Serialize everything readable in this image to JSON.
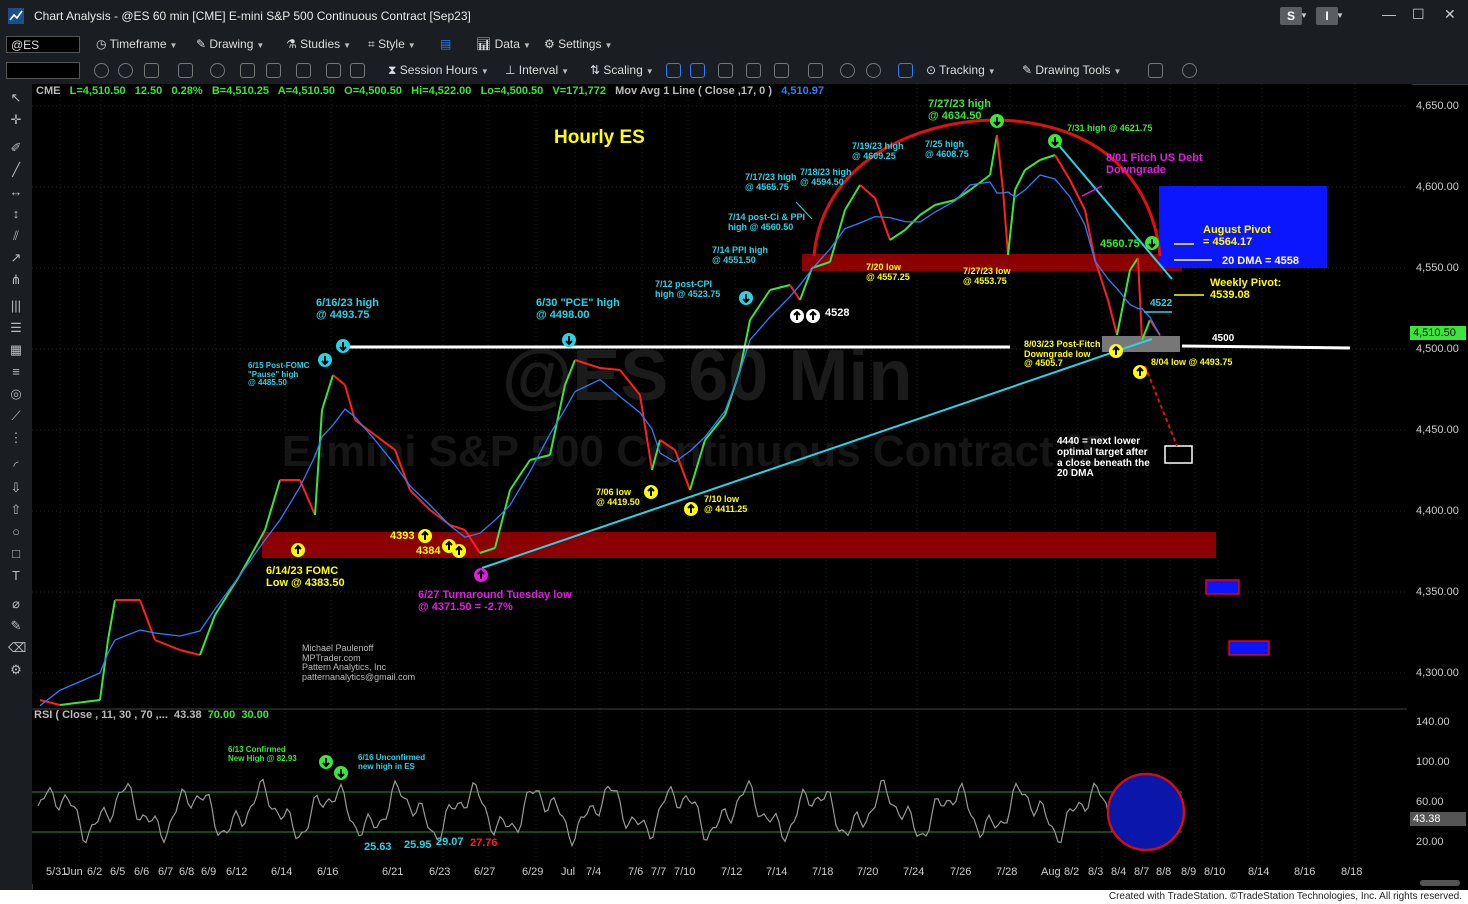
{
  "window": {
    "title": "Chart Analysis - @ES 60 min [CME] E-mini S&P 500 Continuous Contract [Sep23]",
    "buttons": [
      "S",
      "I"
    ]
  },
  "toolbar1": {
    "symbol": "@ES",
    "items": [
      "Timeframe",
      "Drawing",
      "Studies",
      "Style",
      "Data",
      "Settings"
    ]
  },
  "toolbar2": {
    "items": [
      "Session Hours",
      "Interval",
      "Scaling",
      "Tracking",
      "Drawing Tools"
    ]
  },
  "header": {
    "exchange": "CME",
    "last": "L=4,510.50",
    "change": "12.50",
    "pct": "0.28%",
    "bid": "B=4,510.25",
    "ask": "A=4,510.50",
    "open": "O=4,500.50",
    "hi": "Hi=4,522.00",
    "lo": "Lo=4,500.50",
    "vol": "V=171,772",
    "study": "Mov Avg 1 Line ( Close ,17, 0 )",
    "study_value": "4,510.97"
  },
  "price_axis": [
    "4,650.00",
    "4,600.00",
    "4,550.00",
    "4,500.00",
    "4,450.00",
    "4,400.00",
    "4,350.00",
    "4,300.00"
  ],
  "current_price": "4,510.50",
  "rsi_axis": [
    "140.00",
    "100.00",
    "60.00",
    "20.00"
  ],
  "rsi_current": "43.38",
  "rsi_header": {
    "label": "RSI ( Close , 11, 30 , 70 ,...",
    "value": "43.38",
    "ob": "70.00",
    "os": "30.00"
  },
  "date_axis": [
    "5/31",
    "Jun",
    "6/2",
    "6/5",
    "6/6",
    "6/7",
    "6/8",
    "6/9",
    "6/12",
    "6/14",
    "6/16",
    "6/21",
    "6/23",
    "6/27",
    "6/29",
    "Jul",
    "7/4",
    "7/6",
    "7/7",
    "7/10",
    "7/12",
    "7/14",
    "7/18",
    "7/20",
    "7/24",
    "7/26",
    "7/28",
    "Aug",
    "8/2",
    "8/3",
    "8/4",
    "8/7",
    "8/8",
    "8/9",
    "8/10",
    "8/14",
    "8/16",
    "8/18"
  ],
  "watermark": {
    "line1": "@ES 60 Min",
    "line2": "E-mini S&P 500 Continuous Contract [S"
  },
  "annotations": {
    "title": "Hourly ES",
    "h616": "6/16/23 high\n@ 4493.75",
    "h630": "6/30 \"PCE\" high\n@ 4498.00",
    "pause615": "6/15 Post-FOMC\n\"Pause\" high\n@ 4485.50",
    "fomc614": "6/14/23 FOMC\nLow @ 4383.50",
    "l4393": "4393",
    "l4384": "4384",
    "tt627": "6/27 Turnaround Tuesday low\n@ 4371.50 = -2.7%",
    "l706": "7/06 low\n@ 4419.50",
    "l710": "7/10 low\n@ 4411.25",
    "cpi712": "7/12 post-CPI\nhigh @ 4523.75",
    "ppi714": "7/14 PPI high\n@ 4551.50",
    "ci714": "7/14 post-Ci & PPI\nhigh @ 4560.50",
    "h717": "7/17/23 high\n@ 4565.75",
    "h718": "7/18/23 high\n@ 4594.50",
    "h719": "7/19/23 high\n@ 4609.25",
    "h725": "7/25 high\n@ 4608.75",
    "h727": "7/27/23 high\n@ 4634.50",
    "h731": "7/31 high @ 4621.75",
    "fitch": "8/01 Fitch US Debt\nDowngrade",
    "l720": "7/20 low\n@ 4557.25",
    "l727": "7/27/23 low\n@ 4553.75",
    "l4528": "4528",
    "h4560": "4560.75",
    "l4522": "4522",
    "l4500": "4500",
    "pf803": "8/03/23 Post-Fitch\nDowngrade low\n@ 4505.7",
    "l804": "8/04 low @ 4493.75",
    "aug_pivot": "August Pivot\n= 4564.17",
    "dma20": "20 DMA = 4558",
    "weekly_pivot": "Weekly Pivot:\n4539.08",
    "target4440": "4440 = next lower\noptimal target after\na close beneath the\n20 DMA",
    "author": "Michael Paulenoff\nMPTrader.com\nPattern Analytics, Inc\npatternanalytics@gmail.com",
    "rsi613": "6/13 Confirmed\nNew High @ 82.93",
    "rsi616": "6/16 Unconfirmed\nnew high in ES",
    "r2563": "25.63",
    "r2595": "25.95",
    "r2907": "29.07",
    "r2776": "27.76"
  },
  "footer": "Created with TradeStation. ©TradeStation Technologies, Inc. All rights reserved.",
  "colors": {
    "bull": "#39e639",
    "bear": "#ff2020",
    "ma": "#2a7fff",
    "trend": "#29d3e6",
    "zone": "#8b0000",
    "pivot_box": "#0b16ff"
  }
}
